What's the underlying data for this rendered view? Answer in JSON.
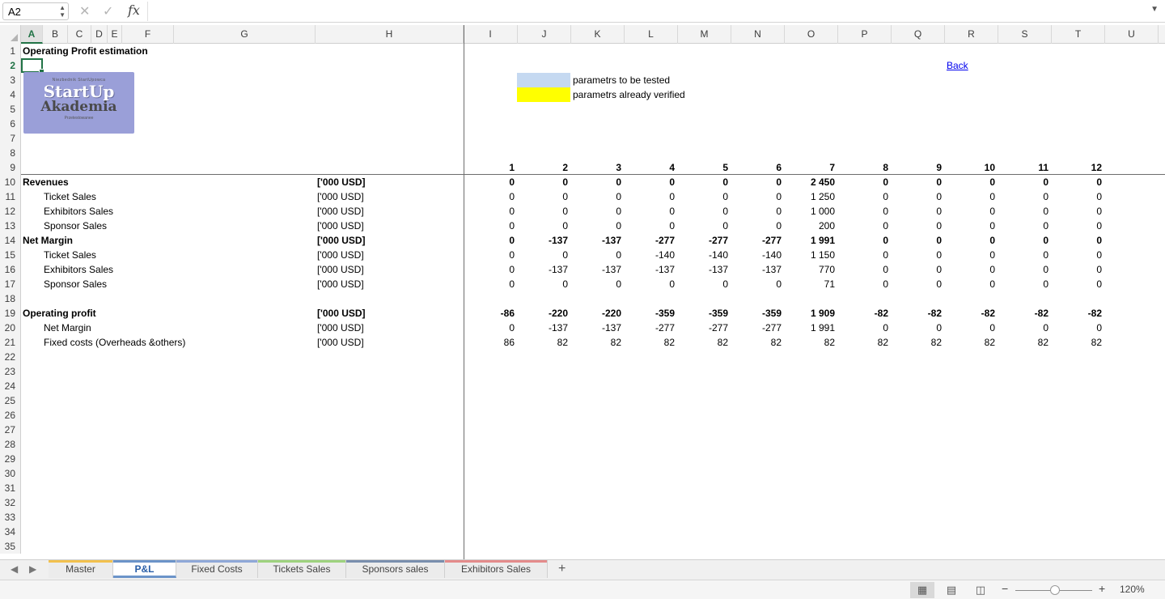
{
  "formula_bar": {
    "name_box": "A2",
    "cancel_icon": "close-icon",
    "enter_icon": "check-icon",
    "fx_label": "fx",
    "formula": ""
  },
  "columns": [
    "A",
    "B",
    "C",
    "D",
    "E",
    "F",
    "G",
    "H",
    "I",
    "J",
    "K",
    "L",
    "M",
    "N",
    "O",
    "P",
    "Q",
    "R",
    "S",
    "T",
    "U"
  ],
  "active_column": "A",
  "rows": [
    "1",
    "2",
    "3",
    "4",
    "5",
    "6",
    "7",
    "8",
    "9",
    "10",
    "11",
    "12",
    "13",
    "14",
    "15",
    "16",
    "17",
    "18",
    "19",
    "20",
    "21",
    "22",
    "23",
    "24",
    "25",
    "26",
    "27",
    "28",
    "29",
    "30",
    "31",
    "32",
    "33",
    "34",
    "35"
  ],
  "active_row": "2",
  "title": "Operating Profit estimation",
  "logo": {
    "line1": "Niezbednik StartUpowca",
    "line2": "StartUp",
    "line3": "Akademia",
    "line4": "Przetestowanee"
  },
  "legend": {
    "tested_label": "parametrs to be tested",
    "tested_color": "#c5d9f1",
    "verified_label": "parametrs already verified",
    "verified_color": "#ffff00"
  },
  "back_link": "Back",
  "month_headers": [
    "1",
    "2",
    "3",
    "4",
    "5",
    "6",
    "7",
    "8",
    "9",
    "10",
    "11",
    "12"
  ],
  "table_rows": [
    {
      "label": "Revenues",
      "unit": "['000 USD]",
      "bold": true,
      "indent": false,
      "values": [
        "0",
        "0",
        "0",
        "0",
        "0",
        "0",
        "2 450",
        "0",
        "0",
        "0",
        "0",
        "0"
      ]
    },
    {
      "label": "Ticket Sales",
      "unit": "['000 USD]",
      "bold": false,
      "indent": true,
      "values": [
        "0",
        "0",
        "0",
        "0",
        "0",
        "0",
        "1 250",
        "0",
        "0",
        "0",
        "0",
        "0"
      ]
    },
    {
      "label": "Exhibitors Sales",
      "unit": "['000 USD]",
      "bold": false,
      "indent": true,
      "values": [
        "0",
        "0",
        "0",
        "0",
        "0",
        "0",
        "1 000",
        "0",
        "0",
        "0",
        "0",
        "0"
      ]
    },
    {
      "label": "Sponsor Sales",
      "unit": "['000 USD]",
      "bold": false,
      "indent": true,
      "values": [
        "0",
        "0",
        "0",
        "0",
        "0",
        "0",
        "200",
        "0",
        "0",
        "0",
        "0",
        "0"
      ]
    },
    {
      "label": "Net Margin",
      "unit": "['000 USD]",
      "bold": true,
      "indent": false,
      "values": [
        "0",
        "-137",
        "-137",
        "-277",
        "-277",
        "-277",
        "1 991",
        "0",
        "0",
        "0",
        "0",
        "0"
      ]
    },
    {
      "label": "Ticket Sales",
      "unit": "['000 USD]",
      "bold": false,
      "indent": true,
      "values": [
        "0",
        "0",
        "0",
        "-140",
        "-140",
        "-140",
        "1 150",
        "0",
        "0",
        "0",
        "0",
        "0"
      ]
    },
    {
      "label": "Exhibitors Sales",
      "unit": "['000 USD]",
      "bold": false,
      "indent": true,
      "values": [
        "0",
        "-137",
        "-137",
        "-137",
        "-137",
        "-137",
        "770",
        "0",
        "0",
        "0",
        "0",
        "0"
      ]
    },
    {
      "label": "Sponsor Sales",
      "unit": "['000 USD]",
      "bold": false,
      "indent": true,
      "values": [
        "0",
        "0",
        "0",
        "0",
        "0",
        "0",
        "71",
        "0",
        "0",
        "0",
        "0",
        "0"
      ]
    },
    null,
    {
      "label": "Operating profit",
      "unit": "['000 USD]",
      "bold": true,
      "indent": false,
      "values": [
        "-86",
        "-220",
        "-220",
        "-359",
        "-359",
        "-359",
        "1 909",
        "-82",
        "-82",
        "-82",
        "-82",
        "-82"
      ]
    },
    {
      "label": "Net Margin",
      "unit": "['000 USD]",
      "bold": false,
      "indent": true,
      "values": [
        "0",
        "-137",
        "-137",
        "-277",
        "-277",
        "-277",
        "1 991",
        "0",
        "0",
        "0",
        "0",
        "0"
      ]
    },
    {
      "label": "Fixed costs (Overheads &others)",
      "unit": "['000 USD]",
      "bold": false,
      "indent": true,
      "values": [
        "86",
        "82",
        "82",
        "82",
        "82",
        "82",
        "82",
        "82",
        "82",
        "82",
        "82",
        "82"
      ]
    }
  ],
  "sheet_tabs": [
    {
      "label": "Master",
      "color": "#f2c14e",
      "active": false
    },
    {
      "label": "P&L",
      "color": "#6c94c9",
      "active": true
    },
    {
      "label": "Fixed Costs",
      "color": "#8fa8d8",
      "active": false
    },
    {
      "label": "Tickets Sales",
      "color": "#9ed27e",
      "active": false
    },
    {
      "label": "Sponsors sales",
      "color": "#7a8fae",
      "active": false
    },
    {
      "label": "Exhibitors Sales",
      "color": "#e48b8b",
      "active": false
    }
  ],
  "add_sheet": "+",
  "status": {
    "zoom": "120%",
    "zoom_fraction": 0.52,
    "view_normal_icon": "grid-view-icon",
    "view_page_layout_icon": "page-layout-icon",
    "view_page_break_icon": "page-break-icon"
  }
}
